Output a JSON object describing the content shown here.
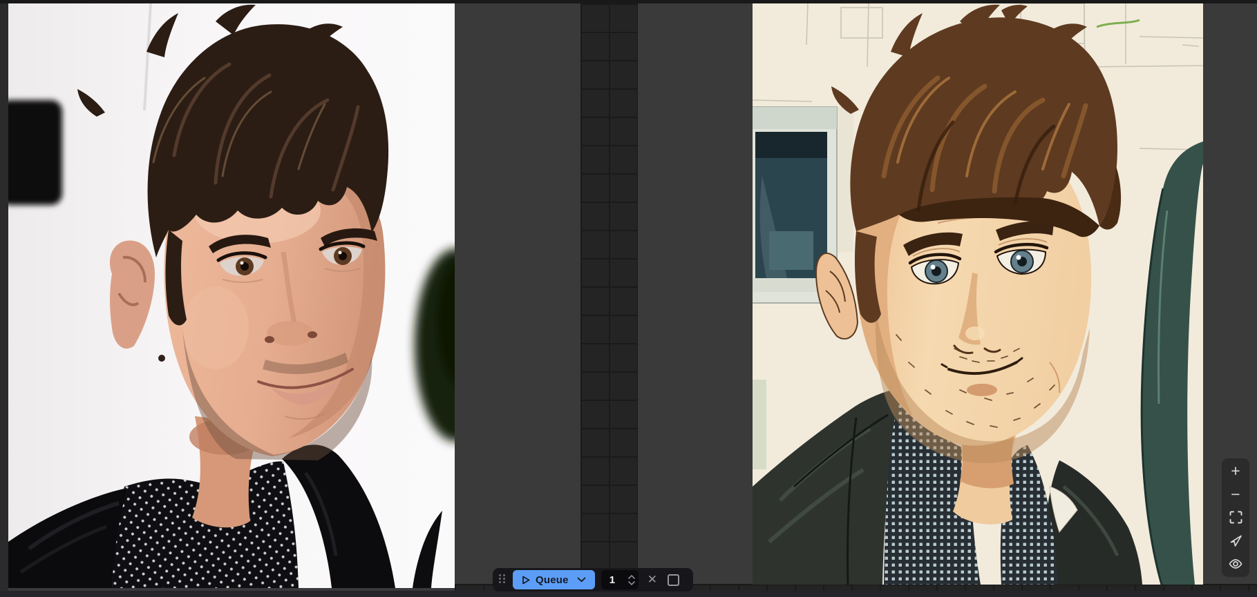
{
  "canvas": {
    "background_color": "#3a3a3a",
    "grid_color": "#242424",
    "bottom_bar_color": "#24242b",
    "left_image_alt": "Reference photo: man with tousled dark brown hair and stubble, slight smile, wearing a black leather jacket over a black polka-dot shirt against a white background",
    "right_image_alt": "Generated anime-style portrait of the same man: messy brown hair, blue-gray eyes, stubble, dark jacket with dotted collar shirt, cream building wall and dark window behind"
  },
  "queue_controls": {
    "queue_label": "Queue",
    "batch_count": "1",
    "cancel_glyph": "✕",
    "accent_color": "#5c9ef7",
    "icons": [
      "drag-handle",
      "play-outline",
      "chevron-down",
      "stepper-up",
      "stepper-down",
      "x-mark",
      "stop-square"
    ]
  },
  "view_controls": {
    "items": [
      {
        "name": "zoom-in",
        "glyph": "+"
      },
      {
        "name": "zoom-out",
        "glyph": "−"
      },
      {
        "name": "fit-view",
        "glyph": "corner-brackets"
      },
      {
        "name": "pointer",
        "glyph": "arrow-cursor"
      },
      {
        "name": "toggle-visibility",
        "glyph": "eye"
      }
    ]
  }
}
